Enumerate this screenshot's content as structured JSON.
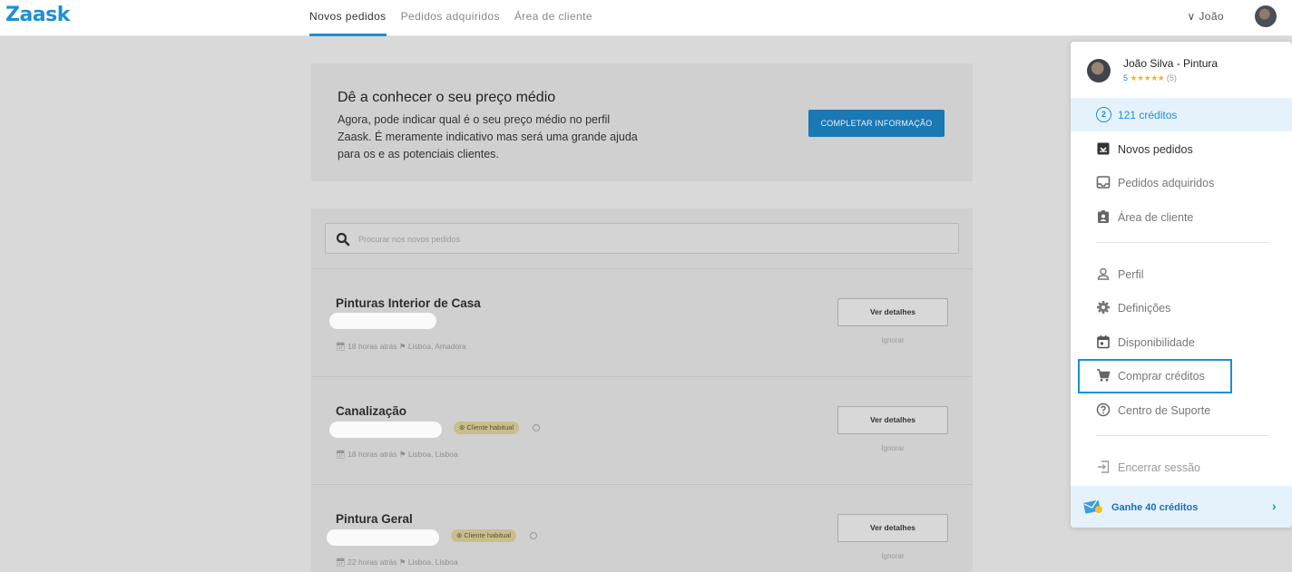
{
  "brand": {
    "logo": "Zaask",
    "accent": "#1c8fd6"
  },
  "nav": {
    "items": [
      {
        "label": "Novos pedidos",
        "active": true
      },
      {
        "label": "Pedidos adquiridos",
        "active": false
      },
      {
        "label": "Área de cliente",
        "active": false
      }
    ],
    "user_label": "João"
  },
  "promo": {
    "title": "Dê a conhecer o seu preço médio",
    "text": "Agora, pode indicar qual é o seu preço médio no perfil Zaask. É meramente indicativo mas será uma grande ajuda para os e as potenciais clientes.",
    "button": "COMPLETAR INFORMAÇÃO"
  },
  "search": {
    "placeholder": "Procurar nos novos pedidos"
  },
  "requests": [
    {
      "title": "Pinturas Interior de Casa",
      "badge": "",
      "time": "18 horas atrás",
      "location": "Lisboa, Amadora",
      "details": "Ver detalhes",
      "ignore": "Ignorar"
    },
    {
      "title": "Canalização",
      "badge": "Cliente habitual",
      "time": "18 horas atrás",
      "location": "Lisboa, Lisboa",
      "details": "Ver detalhes",
      "ignore": "Ignorar"
    },
    {
      "title": "Pintura Geral",
      "badge": "Cliente habitual",
      "time": "22 horas atrás",
      "location": "Lisboa, Lisboa",
      "details": "Ver detalhes",
      "ignore": "Ignorar"
    }
  ],
  "dropdown": {
    "user_name": "João Silva - Pintura",
    "rating_value": "5",
    "rating_stars": "★★★★★",
    "rating_count": "(5)",
    "credits_icon": "2",
    "credits": "121 créditos",
    "menu_primary": [
      {
        "label": "Novos pedidos",
        "icon": "inbox-icon"
      },
      {
        "label": "Pedidos adquiridos",
        "icon": "tray-icon"
      },
      {
        "label": "Área de cliente",
        "icon": "badge-icon"
      }
    ],
    "menu_secondary": [
      {
        "label": "Perfil",
        "icon": "person-icon"
      },
      {
        "label": "Definições",
        "icon": "gear-icon"
      },
      {
        "label": "Disponibilidade",
        "icon": "calendar-icon"
      },
      {
        "label": "Comprar créditos",
        "icon": "cart-icon"
      },
      {
        "label": "Centro de Suporte",
        "icon": "help-icon"
      }
    ],
    "logout": "Encerrar sessão",
    "earn": "Ganhe 40 créditos"
  }
}
